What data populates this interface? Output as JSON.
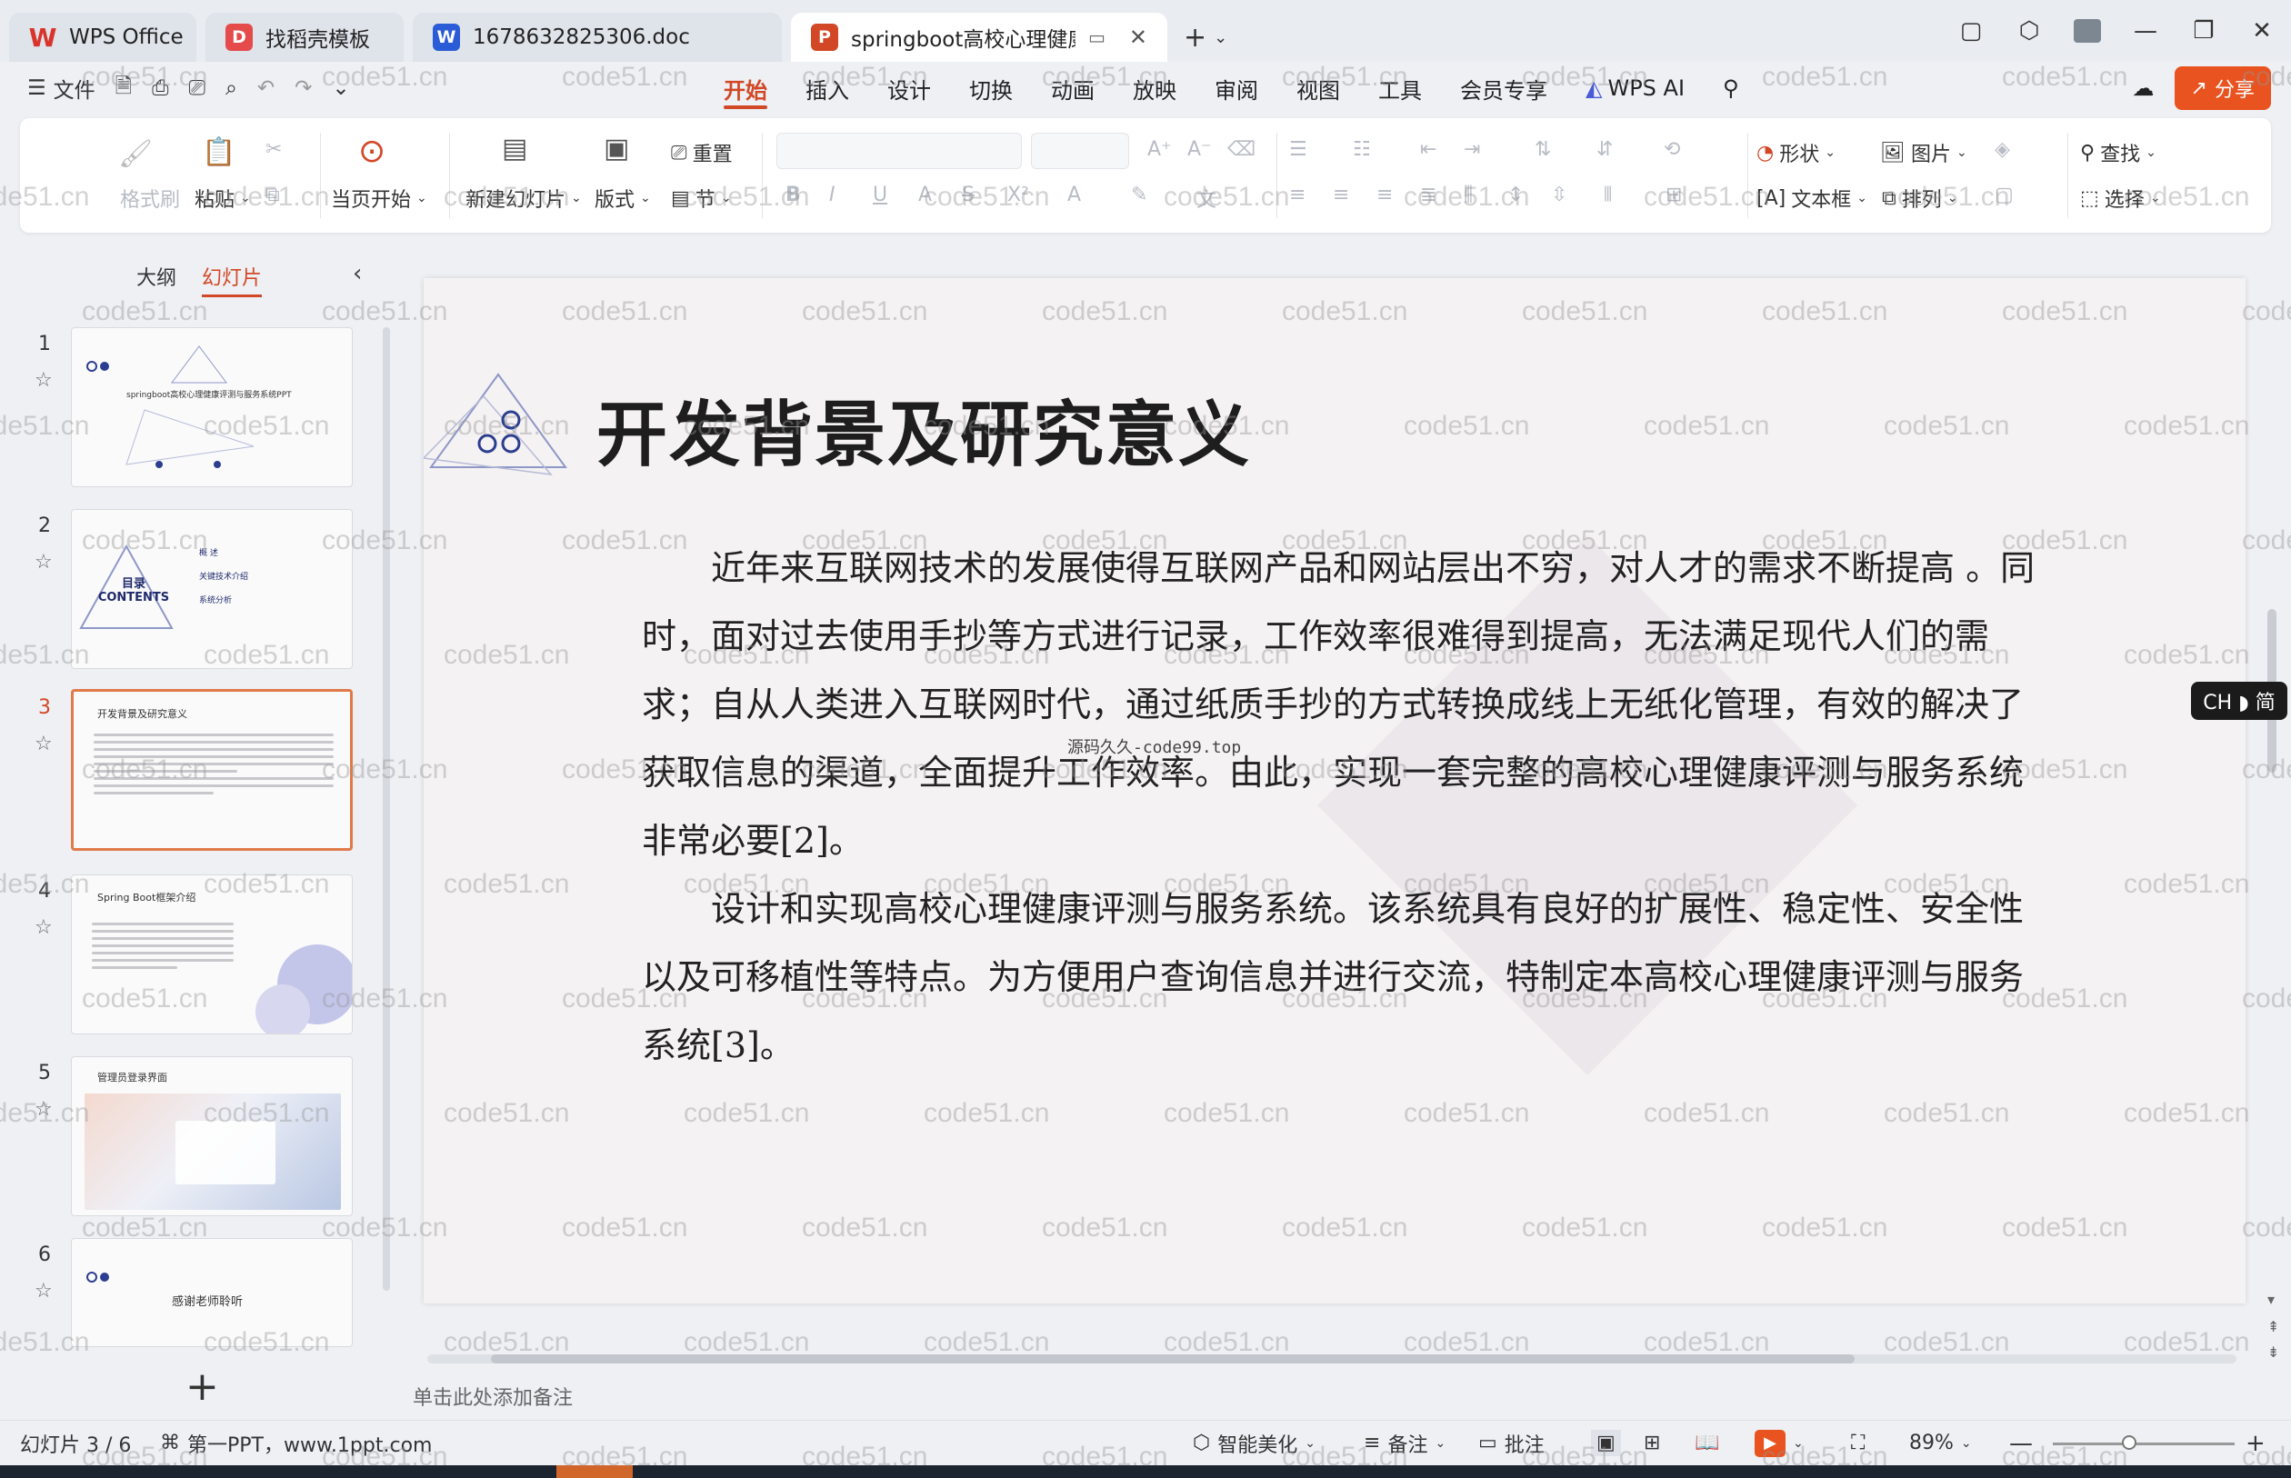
{
  "titlebar": {
    "tabs": [
      {
        "label": "WPS Office",
        "icon": "wps-logo-icon",
        "color": "#d9342b"
      },
      {
        "label": "找稻壳模板",
        "icon": "docer-icon",
        "color": "#e54b4b"
      },
      {
        "label": "1678632825306.doc",
        "icon": "word-doc-icon",
        "color": "#2a5cd7"
      },
      {
        "label": "springboot高校心理健康评测",
        "icon": "ppt-doc-icon",
        "color": "#d24726"
      }
    ],
    "add_tab": "+"
  },
  "menu": {
    "file": "文件",
    "tabs": [
      "开始",
      "插入",
      "设计",
      "切换",
      "动画",
      "放映",
      "审阅",
      "视图",
      "工具",
      "会员专享"
    ],
    "ai": "WPS AI",
    "share": "分享"
  },
  "ribbon": {
    "format_painter": "格式刷",
    "paste": "粘贴",
    "start_from_current": "当页开始",
    "new_slide": "新建幻灯片",
    "layout": "版式",
    "reset": "重置",
    "section": "节",
    "shape": "形状",
    "picture": "图片",
    "find": "查找",
    "textbox": "文本框",
    "arrange": "排列",
    "select": "选择"
  },
  "left_panel": {
    "tab_outline": "大纲",
    "tab_slides": "幻灯片",
    "slides": [
      {
        "num": "1",
        "title": "springboot高校心理健康评测与服务系统PPT"
      },
      {
        "num": "2",
        "title": "目录 CONTENTS",
        "items": [
          "概 述",
          "关键技术介绍",
          "系统分析"
        ]
      },
      {
        "num": "3",
        "title": "开发背景及研究意义"
      },
      {
        "num": "4",
        "title": "Spring Boot框架介绍"
      },
      {
        "num": "5",
        "title": "管理员登录界面"
      },
      {
        "num": "6",
        "title": "感谢老师聆听"
      }
    ]
  },
  "slide": {
    "title": "开发背景及研究意义",
    "para1": "近年来互联网技术的发展使得互联网产品和网站层出不穷，对人才的需求不断提高 。同时，面对过去使用手抄等方式进行记录，工作效率很难得到提高，无法满足现代人们的需求；自从人类进入互联网时代，通过纸质手抄的方式转换成线上无纸化管理，有效的解决了获取信息的渠道，全面提升工作效率。由此，实现一套完整的高校心理健康评测与服务系统非常必要[2]。",
    "para2": "设计和实现高校心理健康评测与服务系统。该系统具有良好的扩展性、稳定性、安全性以及可移植性等特点。为方便用户查询信息并进行交流，特制定本高校心理健康评测与服务系统[3]。",
    "overlay_text": "源码久久-code99.top"
  },
  "notes_placeholder": "单击此处添加备注",
  "ime": "CH ◗ 简",
  "status": {
    "slide_counter": "幻灯片 3 / 6",
    "template": "第一PPT，www.1ppt.com",
    "beautify": "智能美化",
    "notes": "备注",
    "comments": "批注",
    "zoom": "89%"
  },
  "watermark": "code51.cn",
  "colors": {
    "accent": "#d24726",
    "share": "#e8531f"
  }
}
